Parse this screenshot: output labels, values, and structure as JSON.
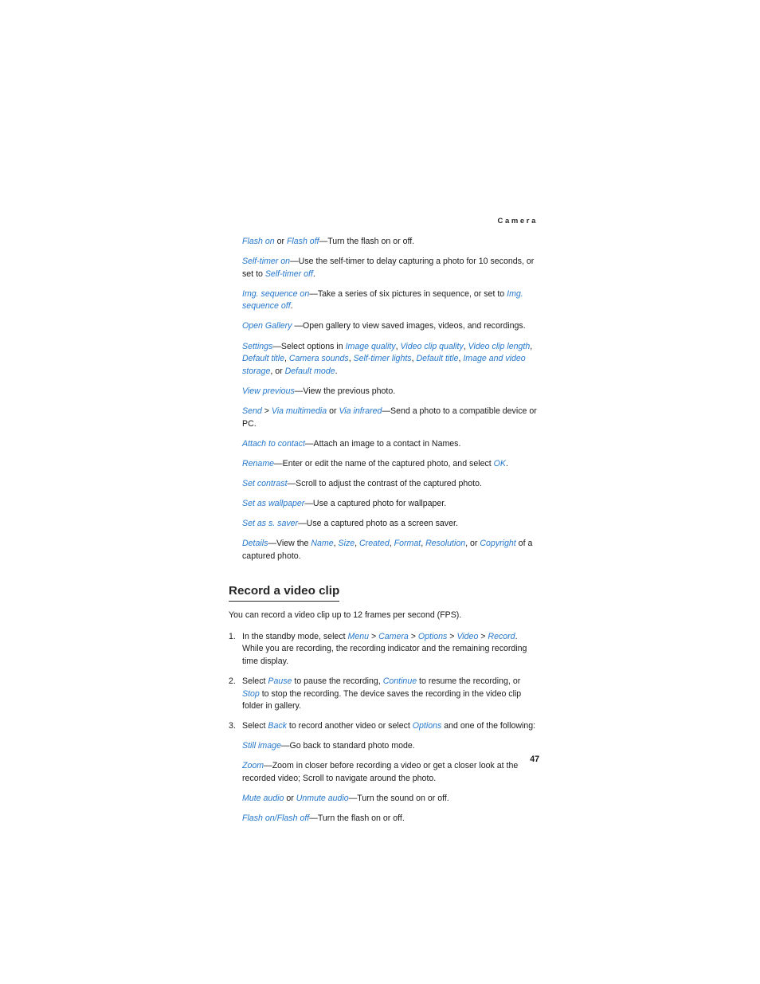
{
  "page": {
    "running_head": "Camera",
    "folio": "47",
    "accent_color": "#2578cd",
    "text_color": "#1a1a1a",
    "background_color": "#ffffff"
  },
  "options": [
    {
      "id": "flash",
      "parts": [
        {
          "style": "term",
          "text": "Flash on"
        },
        {
          "style": "plain",
          "text": " or "
        },
        {
          "style": "term",
          "text": "Flash off"
        },
        {
          "style": "plain",
          "text": "—Turn the flash on or off."
        }
      ]
    },
    {
      "id": "self-timer",
      "parts": [
        {
          "style": "term",
          "text": "Self-timer on"
        },
        {
          "style": "plain",
          "text": "—Use the self-timer to delay capturing a photo for 10 seconds, or set to "
        },
        {
          "style": "term",
          "text": "Self-timer off"
        },
        {
          "style": "plain",
          "text": "."
        }
      ]
    },
    {
      "id": "img-sequence",
      "parts": [
        {
          "style": "term",
          "text": "Img. sequence on"
        },
        {
          "style": "plain",
          "text": "—Take a series of six pictures in sequence, or set to "
        },
        {
          "style": "term",
          "text": "Img. sequence off"
        },
        {
          "style": "plain",
          "text": "."
        }
      ]
    },
    {
      "id": "open-gallery",
      "parts": [
        {
          "style": "term",
          "text": "Open Gallery"
        },
        {
          "style": "plain",
          "text": " —Open gallery to view saved images, videos, and recordings."
        }
      ]
    },
    {
      "id": "settings",
      "parts": [
        {
          "style": "term",
          "text": "Settings"
        },
        {
          "style": "plain",
          "text": "—Select options in "
        },
        {
          "style": "term",
          "text": "Image quality"
        },
        {
          "style": "plain",
          "text": ", "
        },
        {
          "style": "term",
          "text": "Video clip quality"
        },
        {
          "style": "plain",
          "text": ", "
        },
        {
          "style": "term",
          "text": "Video clip length"
        },
        {
          "style": "plain",
          "text": ", "
        },
        {
          "style": "term",
          "text": "Default title"
        },
        {
          "style": "plain",
          "text": ", "
        },
        {
          "style": "term",
          "text": "Camera sounds"
        },
        {
          "style": "plain",
          "text": ", "
        },
        {
          "style": "term",
          "text": "Self-timer lights"
        },
        {
          "style": "plain",
          "text": ", "
        },
        {
          "style": "term",
          "text": "Default title"
        },
        {
          "style": "plain",
          "text": ", "
        },
        {
          "style": "term",
          "text": "Image and video storage"
        },
        {
          "style": "plain",
          "text": ", or "
        },
        {
          "style": "term",
          "text": "Default mode"
        },
        {
          "style": "plain",
          "text": "."
        }
      ]
    },
    {
      "id": "view-previous",
      "parts": [
        {
          "style": "term",
          "text": "View previous"
        },
        {
          "style": "plain",
          "text": "—View the previous photo."
        }
      ]
    },
    {
      "id": "send",
      "parts": [
        {
          "style": "term",
          "text": "Send"
        },
        {
          "style": "plain",
          "text": " > "
        },
        {
          "style": "term",
          "text": "Via multimedia"
        },
        {
          "style": "plain",
          "text": " or "
        },
        {
          "style": "term",
          "text": "Via infrared"
        },
        {
          "style": "plain",
          "text": "—Send a photo to a compatible device or PC."
        }
      ]
    },
    {
      "id": "attach-to-contact",
      "parts": [
        {
          "style": "term",
          "text": "Attach to contact"
        },
        {
          "style": "plain",
          "text": "—Attach an image to a contact in Names."
        }
      ]
    },
    {
      "id": "rename",
      "parts": [
        {
          "style": "term",
          "text": "Rename"
        },
        {
          "style": "plain",
          "text": "—Enter or edit the name of the captured photo, and select "
        },
        {
          "style": "term",
          "text": "OK"
        },
        {
          "style": "plain",
          "text": "."
        }
      ]
    },
    {
      "id": "set-contrast",
      "parts": [
        {
          "style": "term",
          "text": "Set contrast"
        },
        {
          "style": "plain",
          "text": "—Scroll to adjust the contrast of the captured photo."
        }
      ]
    },
    {
      "id": "set-as-wallpaper",
      "parts": [
        {
          "style": "term",
          "text": "Set as wallpaper"
        },
        {
          "style": "plain",
          "text": "—Use a captured photo for wallpaper."
        }
      ]
    },
    {
      "id": "set-as-s-saver",
      "parts": [
        {
          "style": "term",
          "text": "Set as s. saver"
        },
        {
          "style": "plain",
          "text": "—Use a captured photo as a screen saver."
        }
      ]
    },
    {
      "id": "details",
      "parts": [
        {
          "style": "term",
          "text": "Details"
        },
        {
          "style": "plain",
          "text": "—View the "
        },
        {
          "style": "term",
          "text": "Name"
        },
        {
          "style": "plain",
          "text": ", "
        },
        {
          "style": "term",
          "text": "Size"
        },
        {
          "style": "plain",
          "text": ", "
        },
        {
          "style": "term",
          "text": "Created"
        },
        {
          "style": "plain",
          "text": ", "
        },
        {
          "style": "term",
          "text": "Format"
        },
        {
          "style": "plain",
          "text": ", "
        },
        {
          "style": "term",
          "text": "Resolution"
        },
        {
          "style": "plain",
          "text": ", or "
        },
        {
          "style": "term",
          "text": "Copyright"
        },
        {
          "style": "plain",
          "text": " of a captured photo."
        }
      ]
    }
  ],
  "section": {
    "heading": "Record a video clip",
    "intro": "You can record a video clip up to 12 frames per second (FPS).",
    "steps": [
      {
        "number": "1.",
        "parts": [
          {
            "style": "plain",
            "text": "In the standby mode, select "
          },
          {
            "style": "term",
            "text": "Menu"
          },
          {
            "style": "plain",
            "text": " > "
          },
          {
            "style": "term",
            "text": "Camera"
          },
          {
            "style": "plain",
            "text": " > "
          },
          {
            "style": "term",
            "text": "Options"
          },
          {
            "style": "plain",
            "text": " > "
          },
          {
            "style": "term",
            "text": "Video"
          },
          {
            "style": "plain",
            "text": " > "
          },
          {
            "style": "term",
            "text": "Record"
          },
          {
            "style": "plain",
            "text": ". While you are recording, the recording indicator and the remaining recording time display."
          }
        ]
      },
      {
        "number": "2.",
        "parts": [
          {
            "style": "plain",
            "text": "Select "
          },
          {
            "style": "term",
            "text": "Pause"
          },
          {
            "style": "plain",
            "text": " to pause the recording, "
          },
          {
            "style": "term",
            "text": "Continue"
          },
          {
            "style": "plain",
            "text": " to resume the recording, or "
          },
          {
            "style": "term",
            "text": "Stop"
          },
          {
            "style": "plain",
            "text": " to stop the recording. The device saves the recording in the video clip folder in gallery."
          }
        ]
      },
      {
        "number": "3.",
        "parts": [
          {
            "style": "plain",
            "text": "Select "
          },
          {
            "style": "term",
            "text": "Back"
          },
          {
            "style": "plain",
            "text": " to record another video or select "
          },
          {
            "style": "term",
            "text": "Options"
          },
          {
            "style": "plain",
            "text": " and one of the following:"
          }
        ]
      }
    ],
    "sub_options": [
      {
        "id": "still-image",
        "parts": [
          {
            "style": "term",
            "text": "Still image"
          },
          {
            "style": "plain",
            "text": "—Go back to standard photo mode."
          }
        ]
      },
      {
        "id": "zoom",
        "parts": [
          {
            "style": "term",
            "text": "Zoom"
          },
          {
            "style": "plain",
            "text": "—Zoom in closer before recording a video or get a closer look at the recorded video; Scroll to navigate around the photo."
          }
        ]
      },
      {
        "id": "mute-audio",
        "parts": [
          {
            "style": "term",
            "text": "Mute audio"
          },
          {
            "style": "plain",
            "text": " or "
          },
          {
            "style": "term",
            "text": "Unmute audio"
          },
          {
            "style": "plain",
            "text": "—Turn the sound on or off."
          }
        ]
      },
      {
        "id": "flash-video",
        "parts": [
          {
            "style": "term",
            "text": "Flash on"
          },
          {
            "style": "slash",
            "text": "/"
          },
          {
            "style": "term",
            "text": "Flash off"
          },
          {
            "style": "plain",
            "text": "—Turn the flash on or off."
          }
        ]
      }
    ]
  }
}
